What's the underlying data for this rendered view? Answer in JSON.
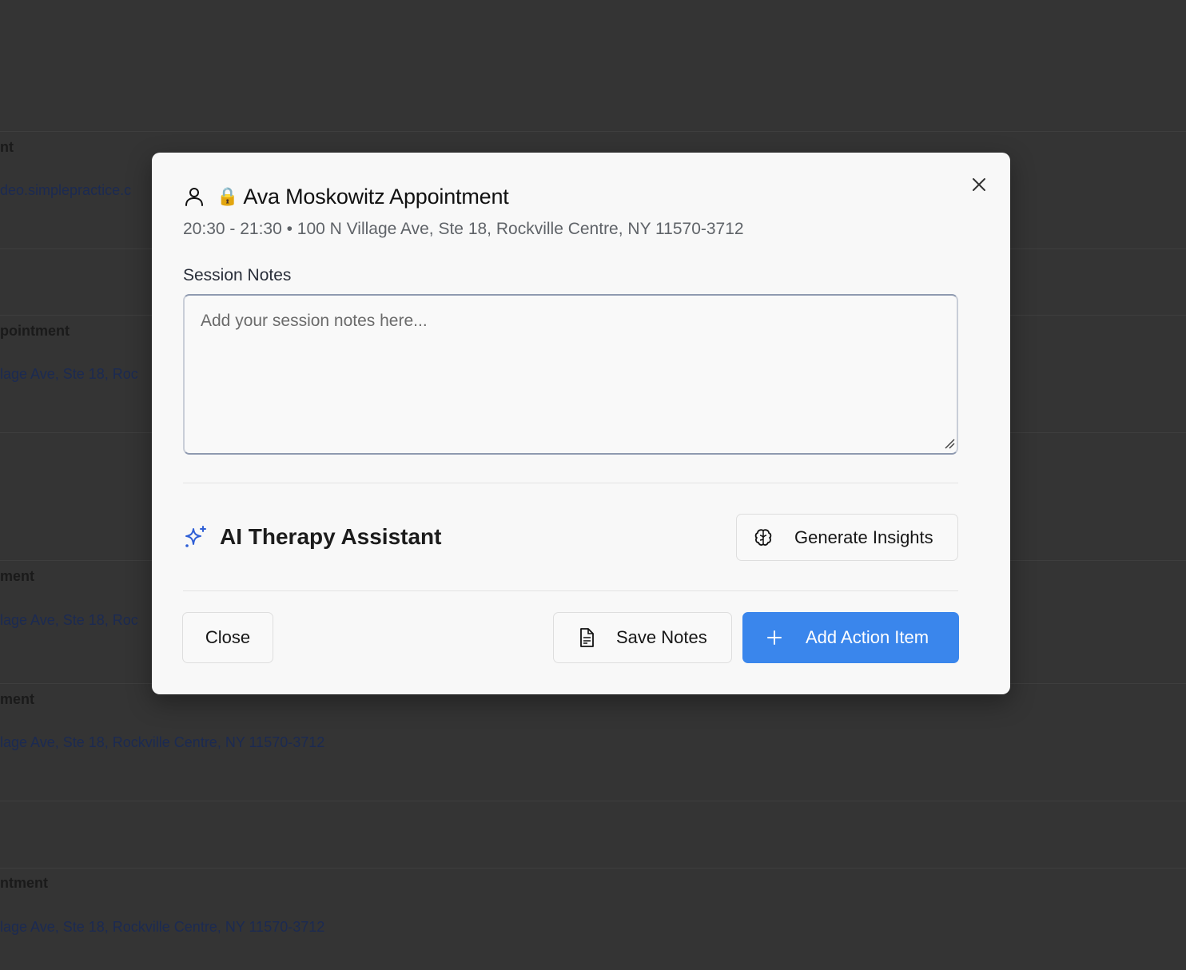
{
  "background": {
    "rows": [
      {
        "title": "nt",
        "link": "deo.simplepractice.c"
      },
      {
        "title": "pointment",
        "link": "lage Ave, Ste 18, Roc"
      },
      {
        "title": "ment",
        "link": "lage Ave, Ste 18, Roc"
      },
      {
        "title": "ment",
        "link": "lage Ave, Ste 18, Rockville Centre, NY 11570-3712"
      },
      {
        "title": "ntment",
        "link": "lage Ave, Ste 18, Rockville Centre, NY 11570-3712"
      }
    ]
  },
  "modal": {
    "lock_emoji": "🔒",
    "title": "Ava Moskowitz Appointment",
    "subtitle": "20:30 - 21:30 • 100 N Village Ave, Ste 18, Rockville Centre, NY 11570-3712",
    "notes_label": "Session Notes",
    "notes_placeholder": "Add your session notes here...",
    "notes_value": "",
    "ai_title": "AI Therapy Assistant",
    "generate_label": "Generate Insights",
    "close_label": "Close",
    "save_label": "Save Notes",
    "add_label": "Add Action Item"
  },
  "icons": {
    "close": "close-icon",
    "person": "user-icon",
    "sparkle": "sparkles-icon",
    "brain": "brain-icon",
    "file": "file-text-icon",
    "plus": "plus-icon"
  },
  "colors": {
    "accent": "#3a86ec",
    "sparkle": "#2f5fd6",
    "overlay": "#343434",
    "modal_bg": "#f8f8f8"
  }
}
